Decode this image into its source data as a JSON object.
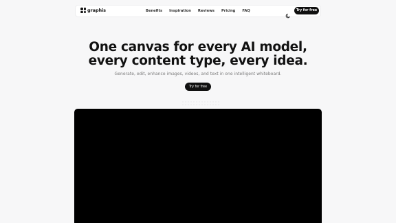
{
  "brand": {
    "name": "graphis"
  },
  "nav": {
    "links": [
      "Benefits",
      "Inspiration",
      "Reviews",
      "Pricing",
      "FAQ"
    ],
    "theme_icon": "moon-icon",
    "cta_label": "Try for free"
  },
  "hero": {
    "title_line1": "One canvas for every AI model,",
    "title_line2": "every content type, every idea.",
    "subtitle": "Generate, edit, enhance images, videos, and text in one intelligent whiteboard.",
    "cta_label": "Try for free"
  },
  "colors": {
    "background": "#f7f7f8",
    "primary": "#111111",
    "muted_text": "#777777",
    "video_bg": "#000000"
  }
}
